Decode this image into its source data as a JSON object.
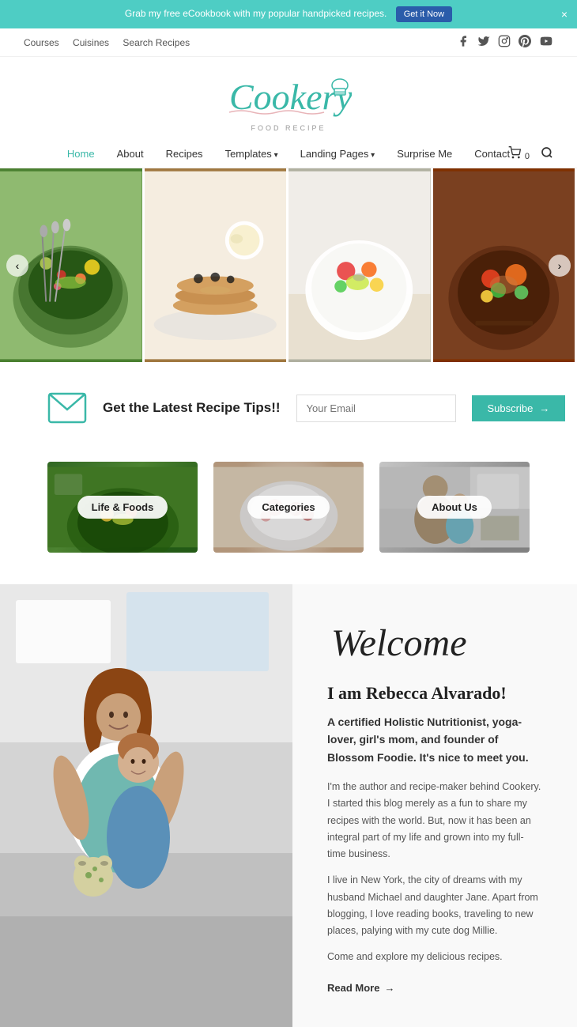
{
  "announcement": {
    "text": "Grab my free eCookbook with my popular handpicked recipes.",
    "btn_label": "Get it Now",
    "close_label": "×"
  },
  "top_nav": {
    "links": [
      {
        "label": "Courses",
        "href": "#"
      },
      {
        "label": "Cuisines",
        "href": "#"
      },
      {
        "label": "Search Recipes",
        "href": "#"
      }
    ],
    "socials": [
      "facebook",
      "twitter",
      "instagram",
      "pinterest",
      "youtube"
    ]
  },
  "logo": {
    "text": "Cookery",
    "subtitle": "FOOD RECIPE",
    "hat_symbol": "🍳"
  },
  "main_nav": {
    "items": [
      {
        "label": "Home",
        "href": "#",
        "active": true,
        "has_arrow": false
      },
      {
        "label": "About",
        "href": "#",
        "active": false,
        "has_arrow": false
      },
      {
        "label": "Recipes",
        "href": "#",
        "active": false,
        "has_arrow": false
      },
      {
        "label": "Templates",
        "href": "#",
        "active": false,
        "has_arrow": true
      },
      {
        "label": "Landing Pages",
        "href": "#",
        "active": false,
        "has_arrow": true
      },
      {
        "label": "Surprise Me",
        "href": "#",
        "active": false,
        "has_arrow": false
      },
      {
        "label": "Contact",
        "href": "#",
        "active": false,
        "has_arrow": false
      }
    ],
    "cart_label": "🛒0",
    "search_label": "🔍"
  },
  "hero": {
    "prev_arrow": "‹",
    "next_arrow": "›"
  },
  "newsletter": {
    "title": "Get the Latest Recipe Tips!!",
    "placeholder": "Your Email",
    "btn_label": "Subscribe",
    "btn_arrow": "→"
  },
  "categories": [
    {
      "label": "Life & Foods"
    },
    {
      "label": "Categories"
    },
    {
      "label": "About Us"
    }
  ],
  "welcome": {
    "heading": "Welcome",
    "name": "I am Rebecca Alvarado!",
    "subtitle": "A certified Holistic Nutritionist, yoga-lover, girl's mom, and founder of Blossom Foodie. It's nice to meet you.",
    "para1": "I'm the author and recipe-maker behind Cookery. I started this blog merely as a fun to share my recipes with the world. But, now it has been an integral part of my life and grown into my full-time business.",
    "para2": "I live in New York, the city of dreams with my husband Michael and daughter Jane. Apart from blogging, I love reading books, traveling to new places, palying with my cute dog Millie.",
    "para3": "Come and explore my delicious recipes.",
    "read_more": "Read More"
  }
}
